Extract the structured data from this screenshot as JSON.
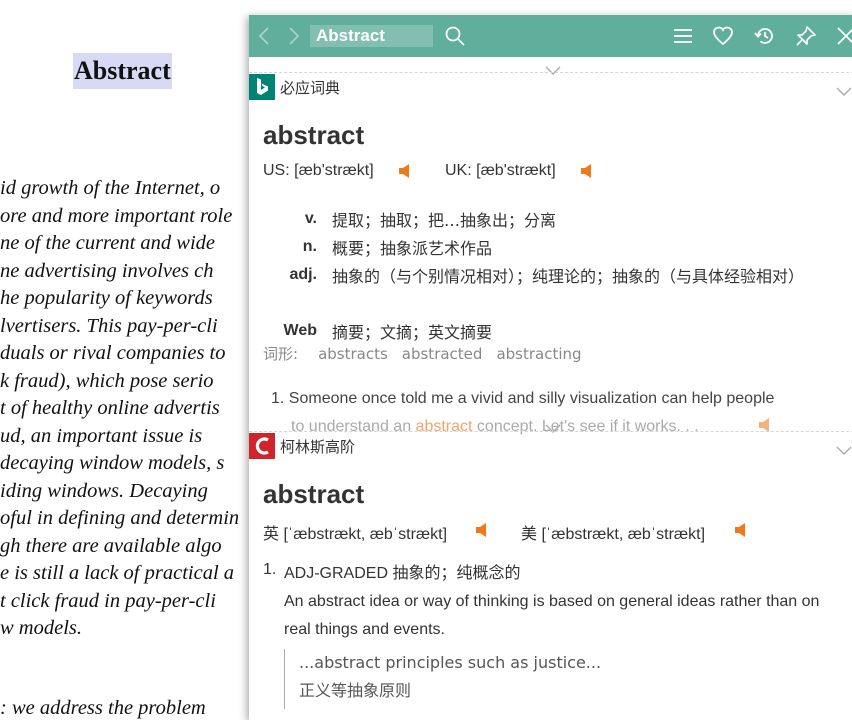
{
  "paper": {
    "title": "Abstract",
    "lines": [
      "id growth of the Internet, o",
      "ore and more important role",
      "ne of the current and wide",
      "ne advertising involves ch",
      "he popularity of keywords",
      "lvertisers. This pay-per-cli",
      "duals or rival companies to",
      "k fraud), which pose serio",
      "t of healthy online advertis",
      "ud, an important issue is",
      "decaying window models, s",
      "iding windows. Decaying",
      "oful in defining and determin",
      "gh there are available algo",
      "e is still a lack of practical a",
      "t click fraud in pay-per-cli",
      "w models."
    ],
    "bottom_line": ": we address the problem"
  },
  "toolbar": {
    "search_value": "Abstract",
    "icons": [
      "back-arrow",
      "forward-arrow",
      "search",
      "menu",
      "heart",
      "history",
      "pin",
      "close"
    ]
  },
  "bing": {
    "dict_name": "必应词典",
    "headword": "abstract",
    "us_pron": "US: [æb'strækt]",
    "uk_pron": "UK: [æb'strækt]",
    "senses": [
      {
        "pos": "v.",
        "def": "提取；抽取；把…抽象出；分离"
      },
      {
        "pos": "n.",
        "def": "概要；抽象派艺术作品"
      },
      {
        "pos": "adj.",
        "def": "抽象的（与个别情况相对）；纯理论的；抽象的（与具体经验相对）"
      },
      {
        "pos": "Web",
        "def": "摘要；文摘；英文摘要"
      }
    ],
    "forms_label": "词形:",
    "forms": [
      "abstracts",
      "abstracted",
      "abstracting"
    ],
    "example_num": "1.",
    "example_pre": "Someone once told me a vivid and silly visualization can help people",
    "example_line2_pre": "to understand an ",
    "example_hl": "abstract",
    "example_line2_post": " concept. Let's see if it works. . ."
  },
  "collins": {
    "dict_name": "柯林斯高阶",
    "headword": "abstract",
    "uk_label": "英",
    "uk_pron": "[ˈæbstrækt, æbˈstrækt]",
    "us_label": "美",
    "us_pron": "[ˈæbstrækt, æbˈstrækt]",
    "sense_num": "1.",
    "sense_head": "ADJ-GRADED 抽象的；纯概念的",
    "sense_def": "An abstract idea or way of thinking is based on general ideas rather than on real things and events.",
    "quote_en": "...abstract principles such as justice...",
    "quote_zh": "正义等抽象原则"
  },
  "colors": {
    "toolbar": "#60ae9c",
    "speaker": "#f07a1a",
    "bing_logo": "#008373",
    "collins_logo": "#d0232b",
    "highlight": "#d8d9f5"
  }
}
